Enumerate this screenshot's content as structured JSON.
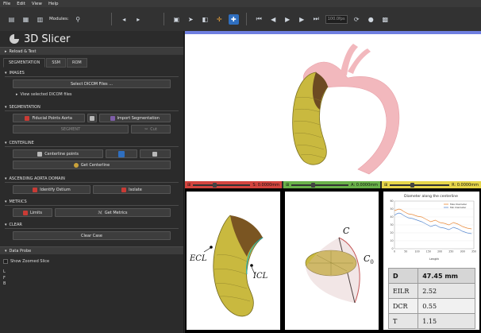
{
  "menu": [
    "File",
    "Edit",
    "View",
    "Help"
  ],
  "toolbar": {
    "module_label": "Modules:",
    "slice_field": "100.0fps"
  },
  "app_title": "3D Slicer",
  "left": {
    "reload_header": "Reload & Test",
    "tabs": [
      "SEGMENTATION",
      "SSM",
      "ROM"
    ],
    "images": {
      "header": "IMAGES",
      "select_dicom": "Select DICOM Files ...",
      "view_dicom": "View selected DICOM files"
    },
    "segmentation": {
      "header": "SEGMENTATION",
      "fiducial": "Fiducial Points Aorta",
      "import": "Import Segmentation",
      "segment": "SEGMENT",
      "cut": "Cut"
    },
    "centerline": {
      "header": "CENTERLINE",
      "points": "Centerline points",
      "get": "Get Centerline"
    },
    "ascending": {
      "header": "ASCENDING AORTA DOMAIN",
      "identify": "Identify Ostium",
      "isolate": "Isolate"
    },
    "metrics": {
      "header": "METRICS",
      "limits": "Limits",
      "get": "Get Metrics"
    },
    "clear": {
      "header": "CLEAR",
      "clear_case": "Clear Case"
    },
    "probe": {
      "header": "Data Probe",
      "show_zoomed": "Show Zoomed Slice",
      "lines": [
        "L",
        "F",
        "B"
      ]
    }
  },
  "slicebars": {
    "red": "S: 0.0000mm",
    "green": "A: 0.0000mm",
    "yellow": "R: 0.0000mm"
  },
  "labels": {
    "ecl": "ECL",
    "icl": "ICL",
    "c": "C",
    "c0": "C",
    "c0_sub": "0"
  },
  "chart_data": {
    "type": "line",
    "title": "Diameter along the centerline",
    "xlabel": "Length",
    "ylabel": "",
    "xlim": [
      0,
      350
    ],
    "ylim": [
      0,
      60
    ],
    "series": [
      {
        "name": "Max Diameter",
        "color": "#e8893a",
        "x": [
          0,
          10,
          20,
          30,
          40,
          60,
          80,
          100,
          120,
          140,
          160,
          180,
          200,
          220,
          240,
          260,
          280,
          300,
          320,
          340
        ],
        "values": [
          48,
          49,
          50,
          49,
          47,
          44,
          43,
          41,
          40,
          37,
          34,
          36,
          33,
          32,
          30,
          33,
          31,
          28,
          26,
          25
        ]
      },
      {
        "name": "Min Diameter",
        "color": "#5b8bd0",
        "x": [
          0,
          10,
          20,
          30,
          40,
          60,
          80,
          100,
          120,
          140,
          160,
          180,
          200,
          220,
          240,
          260,
          280,
          300,
          320,
          340
        ],
        "values": [
          42,
          44,
          45,
          44,
          42,
          39,
          38,
          36,
          34,
          31,
          28,
          30,
          27,
          26,
          24,
          27,
          25,
          22,
          20,
          19
        ]
      }
    ]
  },
  "metrics_table": {
    "rows": [
      {
        "key": "D",
        "value": "47.45 mm"
      },
      {
        "key": "EILR",
        "value": "2.52"
      },
      {
        "key": "DCR",
        "value": "0.55"
      },
      {
        "key": "T",
        "value": "1.15"
      }
    ]
  },
  "colors": {
    "vessel": "#c9b93f",
    "aorta": "#f2b8bd",
    "accent": "#2f6fc0"
  }
}
